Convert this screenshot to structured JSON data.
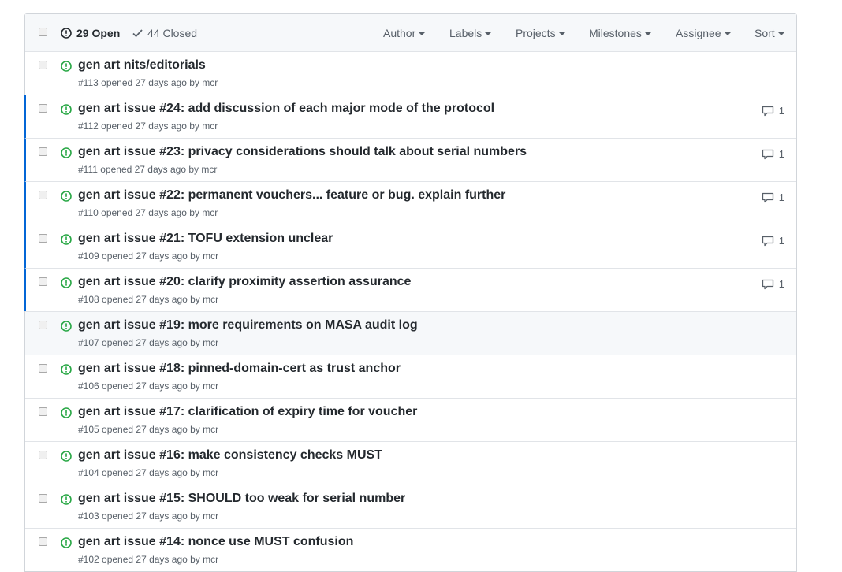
{
  "header": {
    "open_count": "29 Open",
    "closed_count": "44 Closed",
    "filters": [
      "Author",
      "Labels",
      "Projects",
      "Milestones",
      "Assignee",
      "Sort"
    ]
  },
  "colors": {
    "open_green": "#28a745",
    "unread_blue": "#0366d6"
  },
  "issues": [
    {
      "title": "gen art nits/editorials",
      "meta": "#113 opened 27 days ago by mcr",
      "comments": "",
      "unread": false
    },
    {
      "title": "gen art issue #24: add discussion of each major mode of the protocol",
      "meta": "#112 opened 27 days ago by mcr",
      "comments": "1",
      "unread": true
    },
    {
      "title": "gen art issue #23: privacy considerations should talk about serial numbers",
      "meta": "#111 opened 27 days ago by mcr",
      "comments": "1",
      "unread": true
    },
    {
      "title": "gen art issue #22: permanent vouchers... feature or bug. explain further",
      "meta": "#110 opened 27 days ago by mcr",
      "comments": "1",
      "unread": true
    },
    {
      "title": "gen art issue #21: TOFU extension unclear",
      "meta": "#109 opened 27 days ago by mcr",
      "comments": "1",
      "unread": true
    },
    {
      "title": "gen art issue #20: clarify proximity assertion assurance",
      "meta": "#108 opened 27 days ago by mcr",
      "comments": "1",
      "unread": true
    },
    {
      "title": "gen art issue #19: more requirements on MASA audit log",
      "meta": "#107 opened 27 days ago by mcr",
      "comments": "",
      "unread": false
    },
    {
      "title": "gen art issue #18: pinned-domain-cert as trust anchor",
      "meta": "#106 opened 27 days ago by mcr",
      "comments": "",
      "unread": false
    },
    {
      "title": "gen art issue #17: clarification of expiry time for voucher",
      "meta": "#105 opened 27 days ago by mcr",
      "comments": "",
      "unread": false
    },
    {
      "title": "gen art issue #16: make consistency checks MUST",
      "meta": "#104 opened 27 days ago by mcr",
      "comments": "",
      "unread": false
    },
    {
      "title": "gen art issue #15: SHOULD too weak for serial number",
      "meta": "#103 opened 27 days ago by mcr",
      "comments": "",
      "unread": false
    },
    {
      "title": "gen art issue #14: nonce use MUST confusion",
      "meta": "#102 opened 27 days ago by mcr",
      "comments": "",
      "unread": false
    }
  ]
}
